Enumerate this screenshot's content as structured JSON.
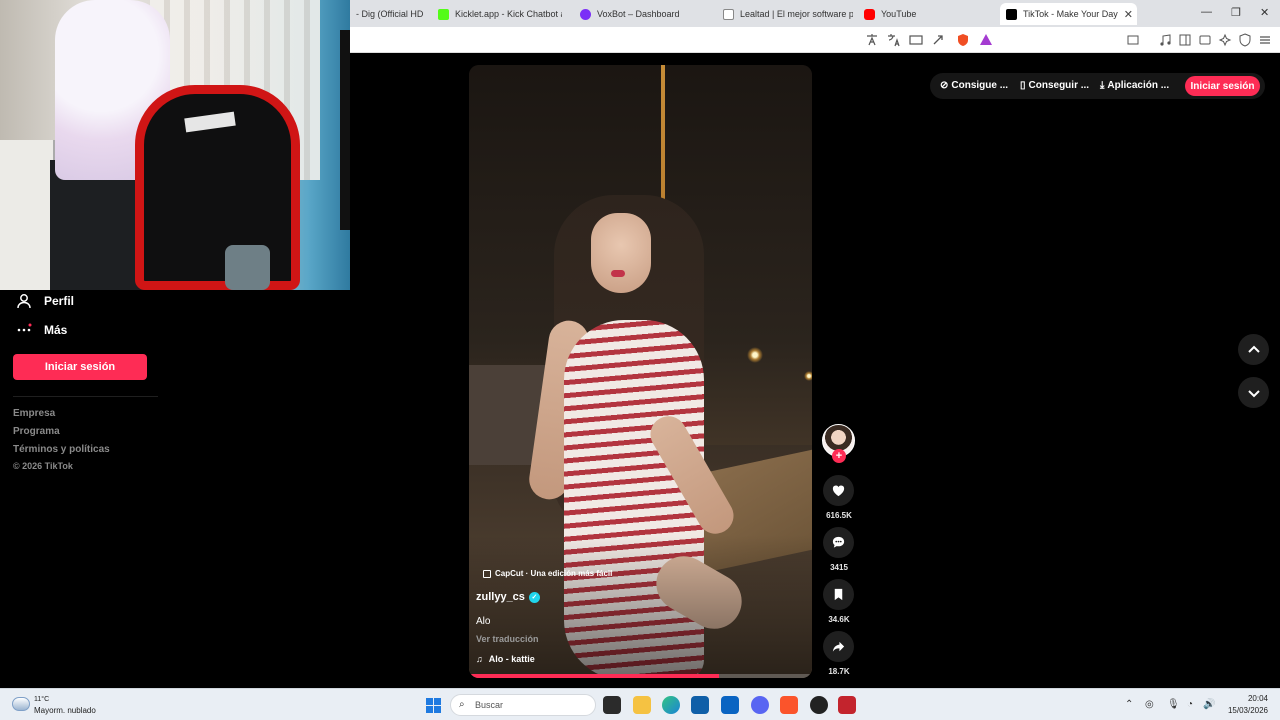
{
  "browser": {
    "tabs": [
      {
        "label": "- Dig (Official HD V",
        "color": "#ffffff"
      },
      {
        "label": "Kicklet.app - Kick Chatbot and",
        "color": "#53fc18"
      },
      {
        "label": "VoxBot – Dashboard",
        "color": "#7b2ff7"
      },
      {
        "label": "Lealtad | El mejor software par",
        "color": "#1a73e8"
      },
      {
        "label": "YouTube",
        "color": "#ff0000"
      },
      {
        "label": "TikTok - Make Your Day",
        "color": "#000000"
      }
    ],
    "new_tab": "+",
    "tab_close": "✕",
    "win_min": "—",
    "win_max": "❐",
    "win_close": "✕"
  },
  "sidebar": {
    "profile_label": "Perfil",
    "more_label": "Más",
    "login_label": "Iniciar sesión",
    "footer_links": [
      "Empresa",
      "Programa",
      "Términos y políticas"
    ],
    "copyright": "© 2026 TikTok"
  },
  "header": {
    "coins_label": "Consigue ...",
    "device_label": "Conseguir ...",
    "app_label": "Aplicación ...",
    "login_label": "Iniciar sesión"
  },
  "video": {
    "capcut_label": "CapCut · Una edición más fácil",
    "username": "zullyy_cs",
    "caption": "Alo",
    "translate_label": "Ver traducción",
    "music": "Alo - kattie",
    "progress": 0.73
  },
  "actions": {
    "likes": "616.5K",
    "comments": "3415",
    "saves": "34.6K",
    "shares": "18.7K"
  },
  "taskbar": {
    "temperature": "11°C",
    "weather": "Mayorm. nublado",
    "search_placeholder": "Buscar",
    "time": "20:04",
    "date": "15/03/2026"
  },
  "colors": {
    "accent": "#fe2c55",
    "verified": "#20d5ec"
  }
}
